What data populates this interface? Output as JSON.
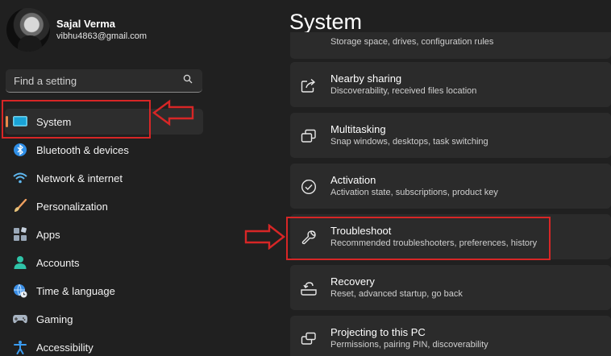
{
  "profile": {
    "name": "Sajal Verma",
    "email": "vibhu4863@gmail.com"
  },
  "search": {
    "placeholder": "Find a setting"
  },
  "sidebar": {
    "items": [
      {
        "label": "System",
        "icon": "monitor-icon",
        "active": true
      },
      {
        "label": "Bluetooth & devices",
        "icon": "bluetooth-icon"
      },
      {
        "label": "Network & internet",
        "icon": "wifi-icon"
      },
      {
        "label": "Personalization",
        "icon": "brush-icon"
      },
      {
        "label": "Apps",
        "icon": "apps-icon"
      },
      {
        "label": "Accounts",
        "icon": "person-icon"
      },
      {
        "label": "Time & language",
        "icon": "globe-clock-icon"
      },
      {
        "label": "Gaming",
        "icon": "gamepad-icon"
      },
      {
        "label": "Accessibility",
        "icon": "accessibility-icon"
      }
    ]
  },
  "main": {
    "title": "System",
    "cards": [
      {
        "subtitle": "Storage space, drives, configuration rules"
      },
      {
        "title": "Nearby sharing",
        "subtitle": "Discoverability, received files location",
        "icon": "share-icon"
      },
      {
        "title": "Multitasking",
        "subtitle": "Snap windows, desktops, task switching",
        "icon": "multitasking-icon"
      },
      {
        "title": "Activation",
        "subtitle": "Activation state, subscriptions, product key",
        "icon": "check-circle-icon"
      },
      {
        "title": "Troubleshoot",
        "subtitle": "Recommended troubleshooters, preferences, history",
        "icon": "wrench-icon"
      },
      {
        "title": "Recovery",
        "subtitle": "Reset, advanced startup, go back",
        "icon": "recovery-icon"
      },
      {
        "title": "Projecting to this PC",
        "subtitle": "Permissions, pairing PIN, discoverability",
        "icon": "projector-icon"
      }
    ]
  },
  "colors": {
    "background": "#202020",
    "card": "#2b2b2b",
    "accent": "#e8894a",
    "annotation": "#d72626"
  }
}
